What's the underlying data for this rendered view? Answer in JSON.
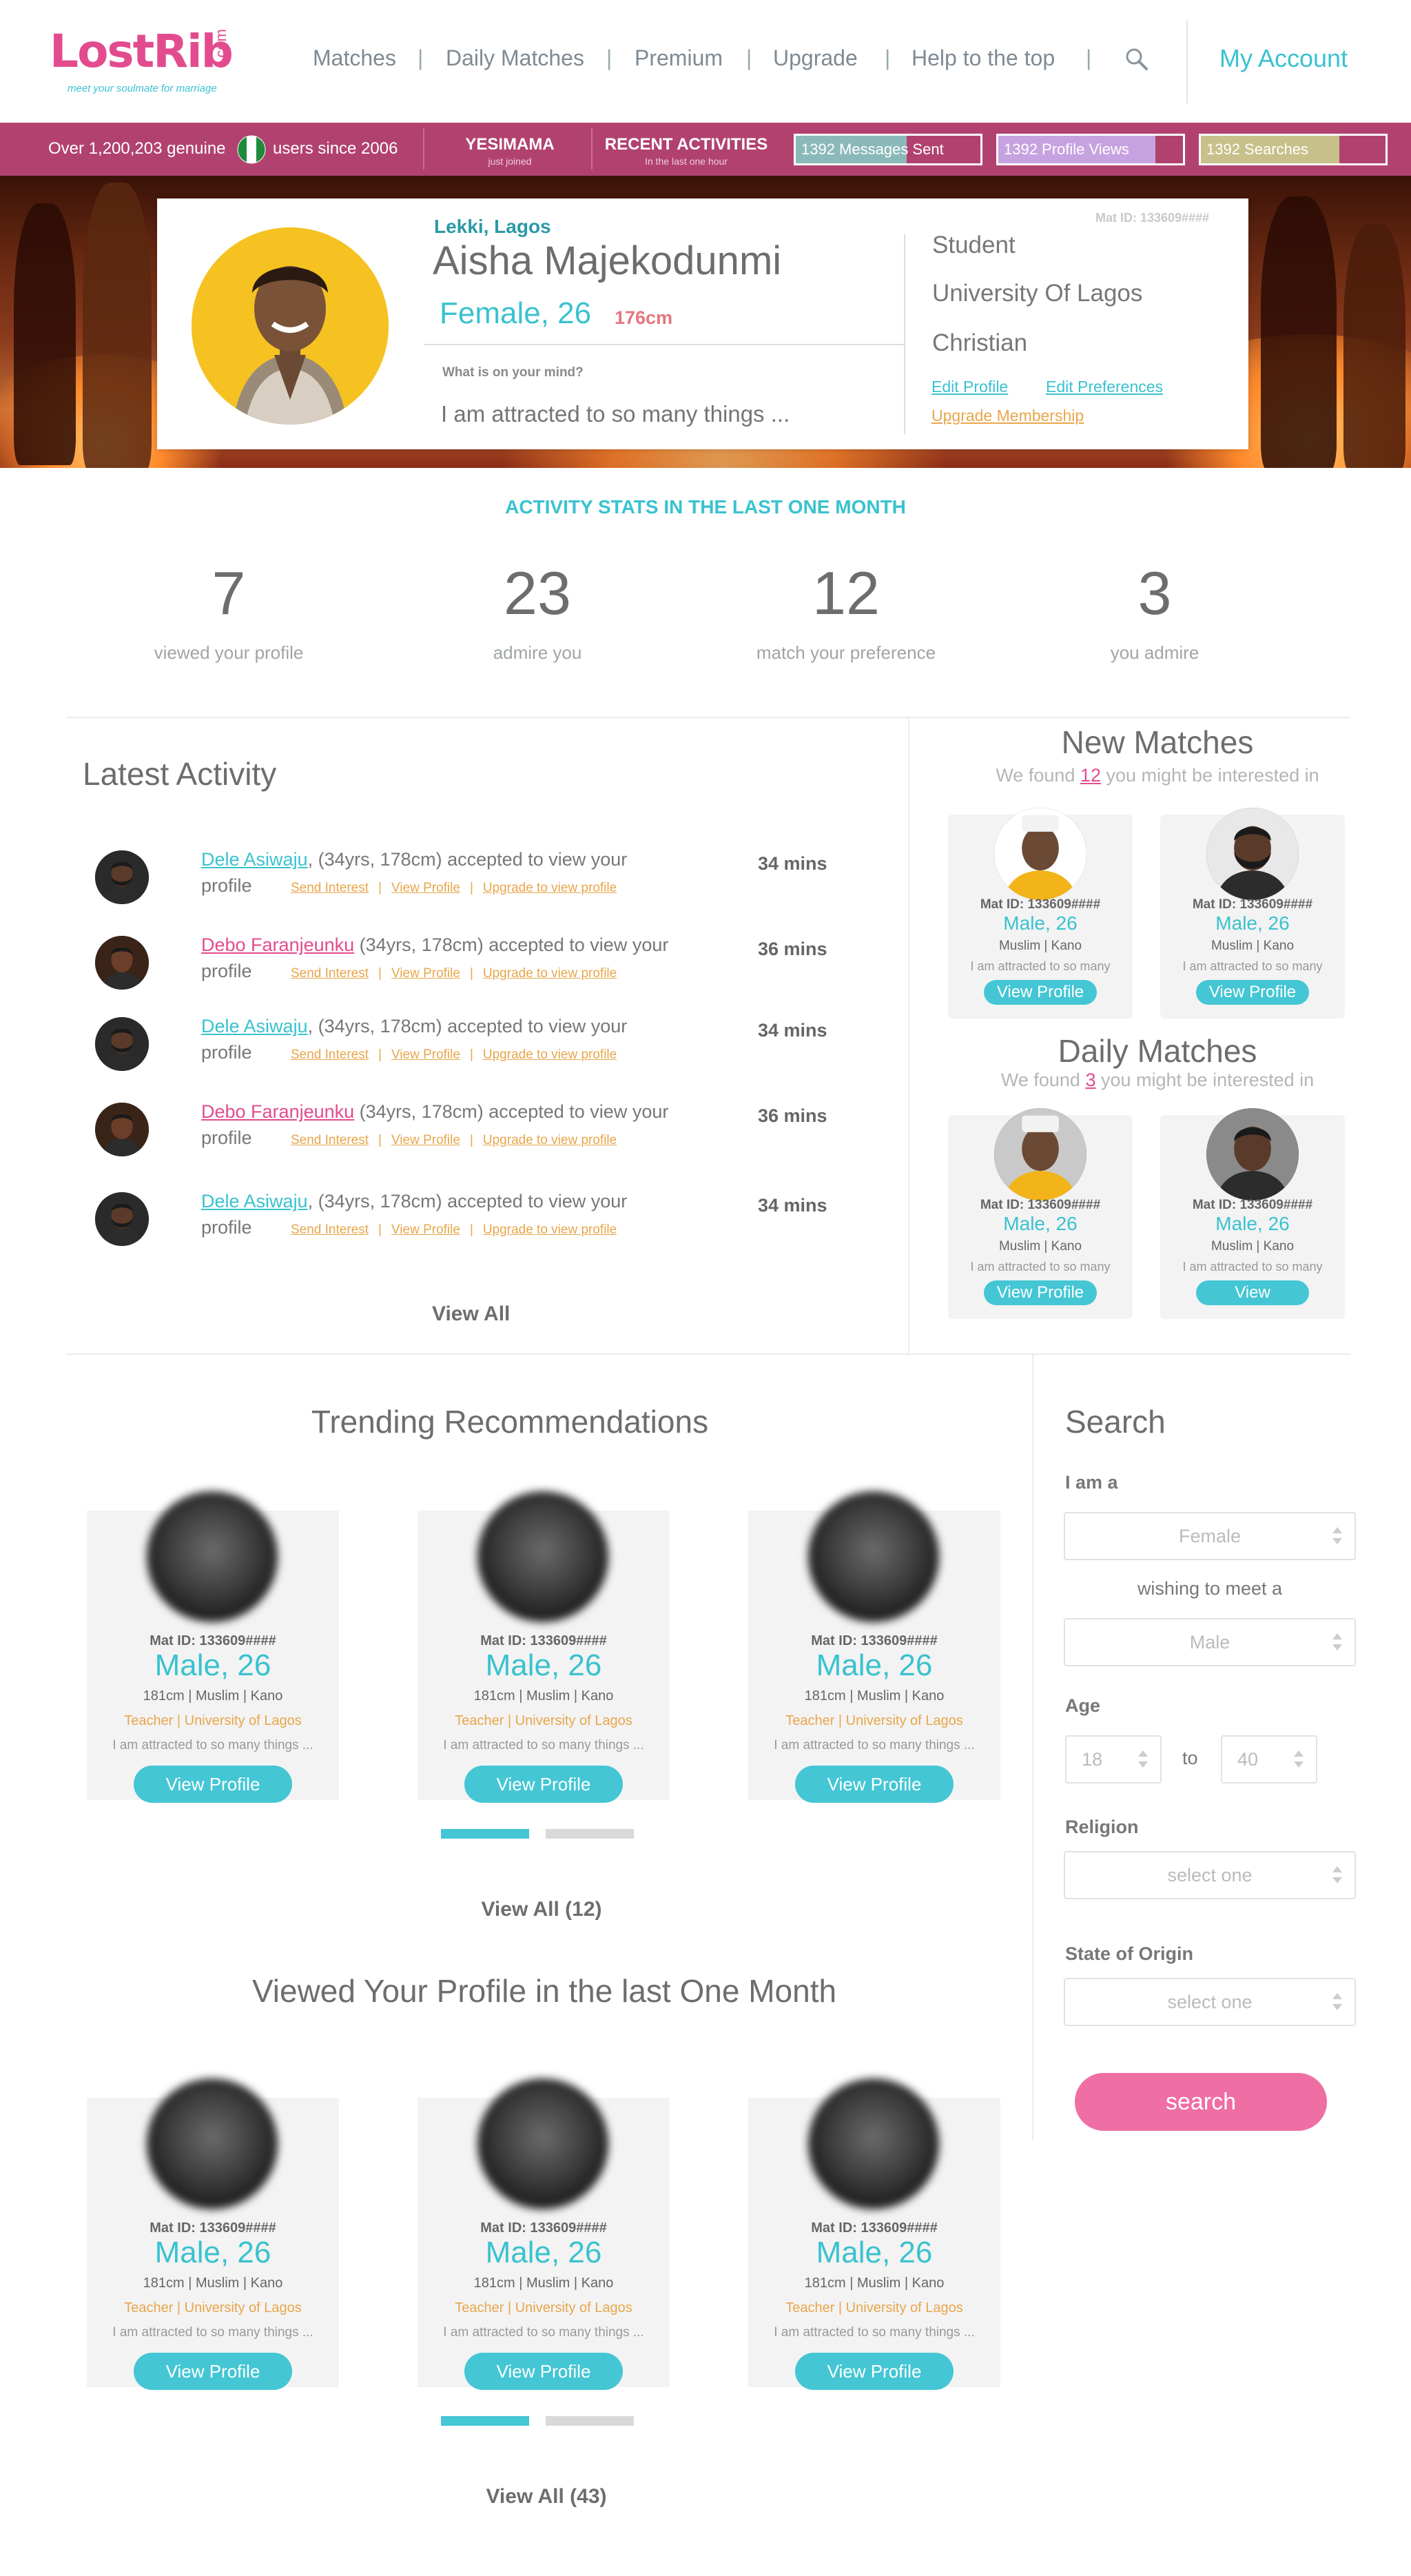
{
  "brand": {
    "logo_text_main": "LostRib",
    "logo_text_com": ".com",
    "tagline": "meet your soulmate for marriage",
    "primary_color": "#39c2cf",
    "accent_color": "#e24c8e",
    "bar_color": "#b1426f"
  },
  "nav": {
    "items": [
      "Matches",
      "Daily Matches",
      "Premium",
      "Upgrade",
      "Help to the top"
    ],
    "separator": "|",
    "my_account": "My Account"
  },
  "topbar": {
    "users_text_before": "Over 1,200,203 genuine",
    "users_text_after": "users since 2006",
    "joined_name": "YESIMAMA",
    "joined_sub": "just joined",
    "recent_title": "RECENT ACTIVITIES",
    "recent_sub": "In the last one hour",
    "messages": "1392 Messages Sent",
    "views": "1392 Profile Views",
    "searches": "1392 Searches",
    "messages_fill": 0.6,
    "views_fill": 0.85,
    "searches_fill": 0.75
  },
  "profile": {
    "location": "Lekki, Lagos",
    "mat_id": "Mat ID: 133609####",
    "name": "Aisha Majekodunmi",
    "gender_age": "Female, 26",
    "height": "176cm",
    "mind_label": "What is on your mind?",
    "mind_placeholder": "I am attracted to so many things ...",
    "occupation": "Student",
    "school": "University Of Lagos",
    "religion": "Christian",
    "edit_profile": "Edit Profile",
    "edit_preferences": "Edit Preferences",
    "upgrade": "Upgrade Membership"
  },
  "stats": {
    "title": "ACTIVITY STATS IN THE LAST ONE MONTH",
    "items": [
      {
        "value": "7",
        "label": "viewed your profile"
      },
      {
        "value": "23",
        "label": "admire you"
      },
      {
        "value": "12",
        "label": "match your preference"
      },
      {
        "value": "3",
        "label": "you admire"
      }
    ]
  },
  "latest": {
    "title": "Latest Activity",
    "view_all": "View All",
    "send_interest": "Send Interest",
    "view_profile": "View Profile",
    "upgrade": "Upgrade to view profile",
    "sep": "|",
    "rows": [
      {
        "name": "Dele Asiwaju",
        "text1": ", (34yrs, 178cm) accepted to view your",
        "text2": "profile",
        "time": "34 mins",
        "color": "teal"
      },
      {
        "name": "Debo Faranjeunku",
        "text1": "  (34yrs, 178cm) accepted to view your",
        "text2": "profile",
        "time": "36 mins",
        "color": "pink"
      },
      {
        "name": "Dele Asiwaju",
        "text1": ", (34yrs, 178cm) accepted to view your",
        "text2": "profile",
        "time": "34 mins",
        "color": "teal"
      },
      {
        "name": "Debo Faranjeunku",
        "text1": "  (34yrs, 178cm) accepted to view your",
        "text2": "profile",
        "time": "36 mins",
        "color": "pink"
      },
      {
        "name": "Dele Asiwaju",
        "text1": ", (34yrs, 178cm) accepted to view your",
        "text2": "profile",
        "time": "34 mins",
        "color": "teal"
      }
    ]
  },
  "new_matches": {
    "title": "New Matches",
    "found_pre": "We found",
    "count": "12",
    "found_post": "you might be interested in",
    "cards": [
      {
        "id": "Mat ID: 133609####",
        "sex": "Male, 26",
        "rel": "Muslim | Kano",
        "about": "I am attracted to so many",
        "btn": "View Profile"
      },
      {
        "id": "Mat ID: 133609####",
        "sex": "Male, 26",
        "rel": "Muslim | Kano",
        "about": "I am attracted to so many",
        "btn": "View Profile"
      }
    ]
  },
  "daily_matches": {
    "title": "Daily Matches",
    "found_pre": "We found",
    "count": "3",
    "found_post": "you might be interested in",
    "cards": [
      {
        "id": "Mat ID: 133609####",
        "sex": "Male, 26",
        "rel": "Muslim | Kano",
        "about": "I am attracted to so many",
        "btn": "View Profile"
      },
      {
        "id": "Mat ID: 133609####",
        "sex": "Male, 26",
        "rel": "Muslim | Kano",
        "about": "I am attracted to so many",
        "btn": "View"
      }
    ]
  },
  "trending": {
    "title": "Trending Recommendations",
    "view_all": "View All (12)",
    "cards": [
      {
        "id": "Mat ID: 133609####",
        "sex": "Male, 26",
        "rel": "181cm | Muslim | Kano",
        "edu": "Teacher  | University of Lagos",
        "about": "I am attracted to so many things ...",
        "btn": "View Profile"
      },
      {
        "id": "Mat ID: 133609####",
        "sex": "Male, 26",
        "rel": "181cm | Muslim | Kano",
        "edu": "Teacher  | University of Lagos",
        "about": "I am attracted to so many things ...",
        "btn": "View Profile"
      },
      {
        "id": "Mat ID: 133609####",
        "sex": "Male, 26",
        "rel": "181cm | Muslim | Kano",
        "edu": "Teacher  | University of Lagos",
        "about": "I am attracted to so many things ...",
        "btn": "View Profile"
      }
    ]
  },
  "viewed": {
    "title": "Viewed Your Profile in the last One Month",
    "view_all": "View All (43)",
    "cards": [
      {
        "id": "Mat ID: 133609####",
        "sex": "Male, 26",
        "rel": "181cm | Muslim | Kano",
        "edu": "Teacher  | University of Lagos",
        "about": "I am attracted to so many things ...",
        "btn": "View Profile"
      },
      {
        "id": "Mat ID: 133609####",
        "sex": "Male, 26",
        "rel": "181cm | Muslim | Kano",
        "edu": "Teacher  | University of Lagos",
        "about": "I am attracted to so many things ...",
        "btn": "View Profile"
      },
      {
        "id": "Mat ID: 133609####",
        "sex": "Male, 26",
        "rel": "181cm | Muslim | Kano",
        "edu": "Teacher  | University of Lagos",
        "about": "I am attracted to so many things ...",
        "btn": "View Profile"
      }
    ]
  },
  "search": {
    "title": "Search",
    "i_am": "I am a",
    "i_am_value": "Female",
    "wishing": "wishing to meet a",
    "wishing_value": "Male",
    "age": "Age",
    "age_from": "18",
    "age_to_label": "to",
    "age_to": "40",
    "religion": "Religion",
    "religion_value": "select one",
    "state": "State of Origin",
    "state_value": "select one",
    "button": "search"
  }
}
